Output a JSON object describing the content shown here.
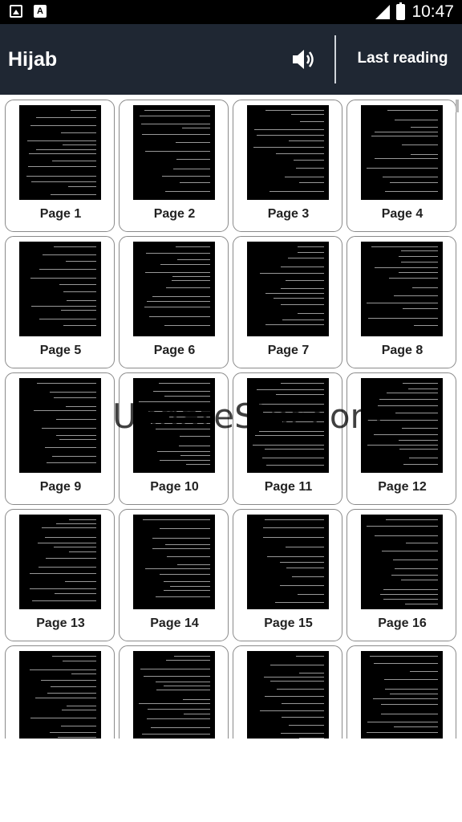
{
  "status_bar": {
    "time": "10:47",
    "left_icons": [
      "gallery-icon",
      "a-letter-icon"
    ],
    "right_icons": [
      "signal-icon",
      "battery-icon"
    ]
  },
  "app_bar": {
    "title": "Hijab",
    "sound_icon": "volume-icon",
    "last_reading_label": "Last reading",
    "background": "#1f2733"
  },
  "pages": [
    {
      "label": "Page 1"
    },
    {
      "label": "Page 2"
    },
    {
      "label": "Page 3"
    },
    {
      "label": "Page 4"
    },
    {
      "label": "Page 5"
    },
    {
      "label": "Page 6"
    },
    {
      "label": "Page 7"
    },
    {
      "label": "Page 8"
    },
    {
      "label": "Page 9"
    },
    {
      "label": "Page 10"
    },
    {
      "label": "Page 11"
    },
    {
      "label": "Page 12"
    },
    {
      "label": "Page 13"
    },
    {
      "label": "Page 14"
    },
    {
      "label": "Page 15"
    },
    {
      "label": "Page 16"
    },
    {
      "label": ""
    },
    {
      "label": ""
    },
    {
      "label": ""
    },
    {
      "label": ""
    }
  ],
  "watermark": "UpdateStar.com"
}
